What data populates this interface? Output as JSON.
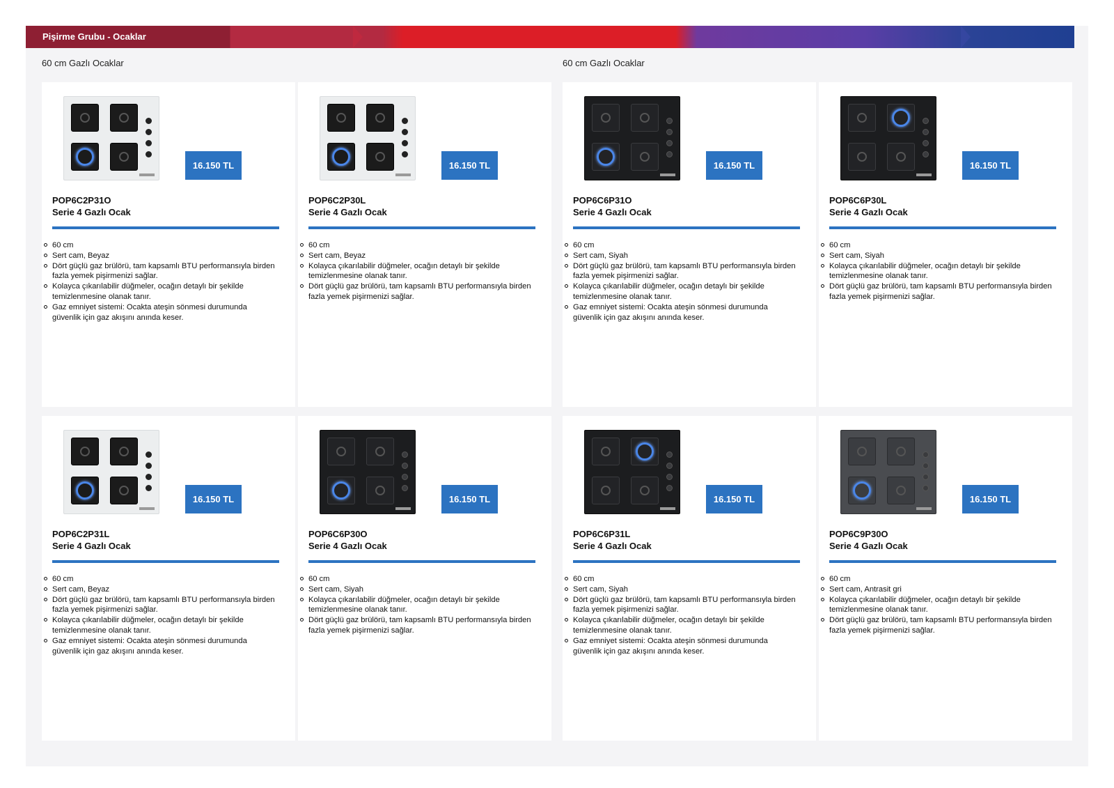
{
  "header": {
    "title": "Pişirme Grubu - Ocaklar"
  },
  "sections": {
    "left": "60 cm Gazlı Ocaklar",
    "right": "60 cm Gazlı Ocaklar"
  },
  "products": [
    {
      "model": "POP6C2P31O",
      "series": "Serie 4 Gazlı Ocak",
      "price": "16.150 TL",
      "color": "white",
      "features": [
        "60 cm",
        "Sert cam, Beyaz",
        "Dört güçlü gaz brülörü, tam kapsamlı BTU performansıyla birden fazla yemek pişirmenizi sağlar.",
        "Kolayca çıkarılabilir düğmeler, ocağın detaylı bir şekilde temizlenmesine olanak tanır.",
        "Gaz emniyet sistemi: Ocakta ateşin sönmesi durumunda güvenlik için gaz akışını anında keser."
      ]
    },
    {
      "model": "POP6C2P30L",
      "series": "Serie 4 Gazlı Ocak",
      "price": "16.150 TL",
      "color": "white",
      "features": [
        "60 cm",
        "Sert cam, Beyaz",
        "Kolayca çıkarılabilir düğmeler, ocağın detaylı bir şekilde temizlenmesine olanak tanır.",
        "Dört güçlü gaz brülörü, tam kapsamlı BTU performansıyla birden fazla yemek pişirmenizi sağlar."
      ]
    },
    {
      "model": "POP6C6P31O",
      "series": "Serie 4 Gazlı Ocak",
      "price": "16.150 TL",
      "color": "black",
      "features": [
        "60 cm",
        "Sert cam, Siyah",
        "Dört güçlü gaz brülörü, tam kapsamlı BTU performansıyla birden fazla yemek pişirmenizi sağlar.",
        "Kolayca çıkarılabilir düğmeler, ocağın detaylı bir şekilde temizlenmesine olanak tanır.",
        "Gaz emniyet sistemi: Ocakta ateşin sönmesi durumunda güvenlik için gaz akışını anında keser."
      ]
    },
    {
      "model": "POP6C6P30L",
      "series": "Serie 4 Gazlı Ocak",
      "price": "16.150 TL",
      "color": "black",
      "features": [
        "60 cm",
        "Sert cam, Siyah",
        "Kolayca çıkarılabilir düğmeler, ocağın detaylı bir şekilde temizlenmesine olanak tanır.",
        "Dört güçlü gaz brülörü, tam kapsamlı BTU performansıyla birden fazla yemek pişirmenizi sağlar."
      ]
    },
    {
      "model": "POP6C2P31L",
      "series": "Serie 4 Gazlı Ocak",
      "price": "16.150 TL",
      "color": "white",
      "features": [
        "60 cm",
        "Sert cam, Beyaz",
        "Dört güçlü gaz brülörü, tam kapsamlı BTU performansıyla birden fazla yemek pişirmenizi sağlar.",
        "Kolayca çıkarılabilir düğmeler, ocağın detaylı bir şekilde temizlenmesine olanak tanır.",
        "Gaz emniyet sistemi: Ocakta ateşin sönmesi durumunda güvenlik için gaz akışını anında keser."
      ]
    },
    {
      "model": "POP6C6P30O",
      "series": "Serie 4 Gazlı Ocak",
      "price": "16.150 TL",
      "color": "black",
      "features": [
        "60 cm",
        "Sert cam, Siyah",
        "Kolayca çıkarılabilir düğmeler, ocağın detaylı bir şekilde temizlenmesine olanak tanır.",
        "Dört güçlü gaz brülörü, tam kapsamlı BTU performansıyla birden fazla yemek pişirmenizi sağlar."
      ]
    },
    {
      "model": "POP6C6P31L",
      "series": "Serie 4 Gazlı Ocak",
      "price": "16.150 TL",
      "color": "black",
      "features": [
        "60 cm",
        "Sert cam, Siyah",
        "Dört güçlü gaz brülörü, tam kapsamlı BTU performansıyla birden fazla yemek pişirmenizi sağlar.",
        "Kolayca çıkarılabilir düğmeler, ocağın detaylı bir şekilde temizlenmesine olanak tanır.",
        "Gaz emniyet sistemi: Ocakta ateşin sönmesi durumunda güvenlik için gaz akışını anında keser."
      ]
    },
    {
      "model": "POP6C9P30O",
      "series": "Serie 4 Gazlı Ocak",
      "price": "16.150 TL",
      "color": "anthracite",
      "features": [
        "60 cm",
        "Sert cam, Antrasit gri",
        "Kolayca çıkarılabilir düğmeler, ocağın detaylı bir şekilde temizlenmesine olanak tanır.",
        "Dört güçlü gaz brülörü, tam kapsamlı BTU performansıyla birden fazla yemek pişirmenizi sağlar."
      ]
    }
  ],
  "colors": {
    "accent": "#2c73c1",
    "header_start": "#8e1f33",
    "header_red": "#dc1e27",
    "header_end": "#1f3f92"
  }
}
